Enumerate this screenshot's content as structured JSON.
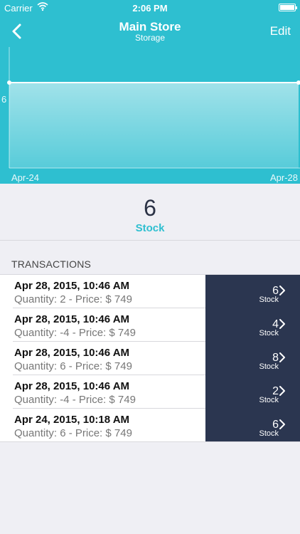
{
  "status_bar": {
    "carrier": "Carrier",
    "time": "2:06 PM"
  },
  "navbar": {
    "title": "Main Store",
    "subtitle": "Storage",
    "edit_label": "Edit"
  },
  "chart_data": {
    "type": "area",
    "x_labels": [
      "Apr-24",
      "Apr-28"
    ],
    "y_labels": [
      "6"
    ],
    "values": [
      6,
      6
    ],
    "color": "#ffffff"
  },
  "summary": {
    "value": "6",
    "label": "Stock"
  },
  "transactions": {
    "header": "TRANSACTIONS",
    "items": [
      {
        "date": "Apr 28, 2015, 10:46 AM",
        "detail": "Quantity: 2 - Price: $ 749",
        "stock": "6",
        "unit": "Stock"
      },
      {
        "date": "Apr 28, 2015, 10:46 AM",
        "detail": "Quantity: -4 - Price: $ 749",
        "stock": "4",
        "unit": "Stock"
      },
      {
        "date": "Apr 28, 2015, 10:46 AM",
        "detail": "Quantity: 6 - Price: $ 749",
        "stock": "8",
        "unit": "Stock"
      },
      {
        "date": "Apr 28, 2015, 10:46 AM",
        "detail": "Quantity: -4 - Price: $ 749",
        "stock": "2",
        "unit": "Stock"
      },
      {
        "date": "Apr 24, 2015, 10:18 AM",
        "detail": "Quantity: 6 - Price: $ 749",
        "stock": "6",
        "unit": "Stock"
      }
    ]
  },
  "colors": {
    "accent": "#2ebfd0",
    "stock_cell": "#2b3650",
    "background": "#efeff4"
  },
  "icons": {
    "back": "chevron-left-icon",
    "row_chevron": "chevron-right-icon",
    "wifi": "wifi-icon",
    "battery": "battery-icon"
  }
}
